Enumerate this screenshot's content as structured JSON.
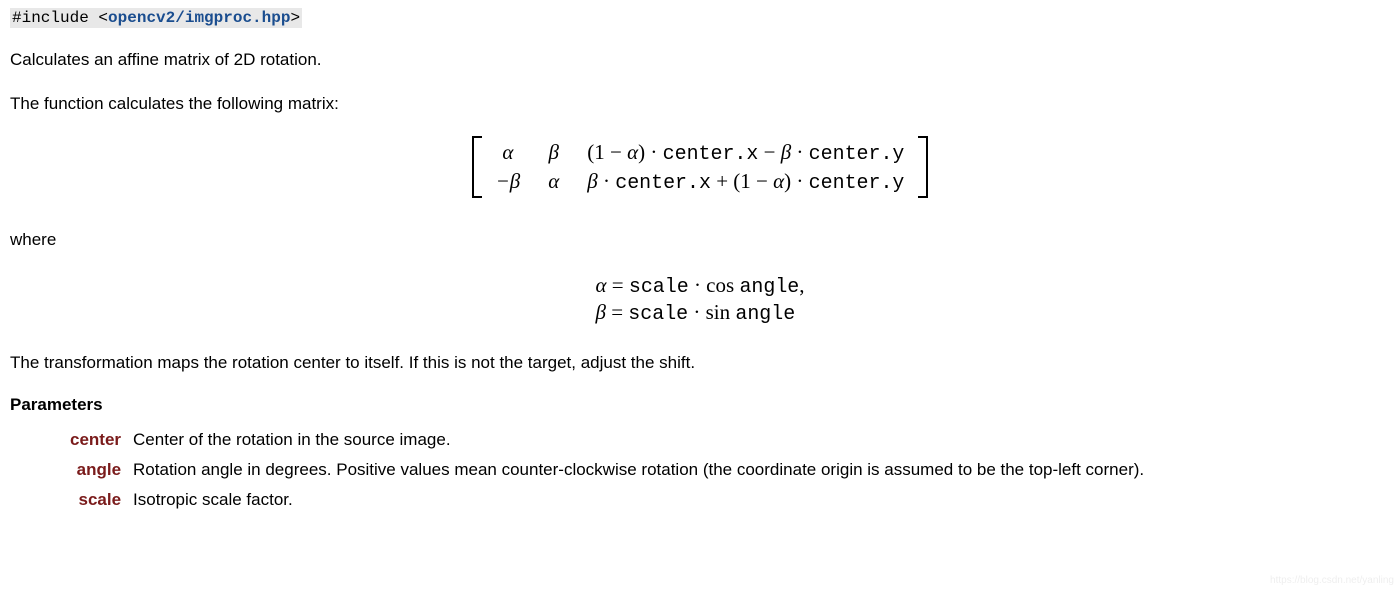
{
  "include": {
    "directive": "#include ",
    "open": "<",
    "path": "opencv2/imgproc.hpp",
    "close": ">"
  },
  "paragraphs": {
    "p1": "Calculates an affine matrix of 2D rotation.",
    "p2": "The function calculates the following matrix:",
    "where": "where",
    "p3": "The transformation maps the rotation center to itself. If this is not the target, adjust the shift."
  },
  "matrix": {
    "r0c0": "α",
    "r0c1": "β",
    "r0c2_a": "(1 − ",
    "r0c2_b": "α",
    "r0c2_c": ") · ",
    "r0c2_d": "center.x",
    "r0c2_e": " − ",
    "r0c2_f": "β",
    "r0c2_g": " · ",
    "r0c2_h": "center.y",
    "r1c0": "−β",
    "r1c1": "α",
    "r1c2_a": "β",
    "r1c2_b": " · ",
    "r1c2_c": "center.x",
    "r1c2_d": " + (1 − ",
    "r1c2_e": "α",
    "r1c2_f": ") · ",
    "r1c2_g": "center.y"
  },
  "equations": {
    "l1_a": "α",
    "l1_b": " = ",
    "l1_c": "scale",
    "l1_d": " · cos ",
    "l1_e": "angle",
    "l1_f": ",",
    "l2_a": "β",
    "l2_b": " = ",
    "l2_c": "scale",
    "l2_d": " · sin ",
    "l2_e": "angle"
  },
  "params": {
    "title": "Parameters",
    "items": [
      {
        "name": "center",
        "desc": "Center of the rotation in the source image."
      },
      {
        "name": "angle",
        "desc": "Rotation angle in degrees. Positive values mean counter-clockwise rotation (the coordinate origin is assumed to be the top-left corner)."
      },
      {
        "name": "scale",
        "desc": "Isotropic scale factor."
      }
    ]
  },
  "watermark": "https://blog.csdn.net/yanling"
}
